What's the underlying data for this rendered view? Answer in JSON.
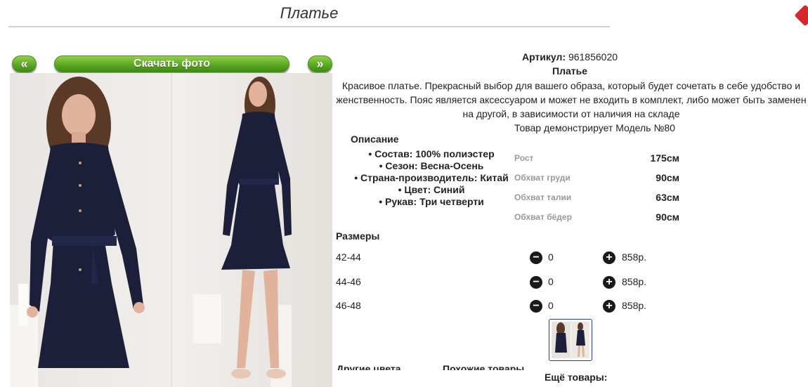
{
  "page": {
    "title": "Платье"
  },
  "toolbar": {
    "prev_label": "«",
    "download_label": "Скачать фото",
    "next_label": "»"
  },
  "product": {
    "artikul_label": "Артикул:",
    "artikul_value": "961856020",
    "name": "Платье",
    "description": "Красивое платье. Прекрасный выбор для вашего образа, который будет сочетать в себе удобство и женственность. Пояс является аксессуаром и может не входить в комплект, либо может быть заменен на другой, в зависимости от наличия на складе",
    "model_note": "Товар демонстрирует Модель №80"
  },
  "description_section": {
    "heading": "Описание",
    "items": [
      "Состав: 100% полиэстер",
      "Сезон: Весна-Осень",
      "Страна-производитель: Китай",
      "Цвет: Синий",
      "Рукав: Три четверти"
    ]
  },
  "measurements": [
    {
      "label": "Рост",
      "value": "175см"
    },
    {
      "label": "Обхват груди",
      "value": "90см"
    },
    {
      "label": "Обхват талии",
      "value": "63см"
    },
    {
      "label": "Обхват бёдер",
      "value": "90см"
    }
  ],
  "sizes": {
    "heading": "Размеры",
    "rows": [
      {
        "size": "42-44",
        "qty": "0",
        "price": "858р."
      },
      {
        "size": "44-46",
        "qty": "0",
        "price": "858р."
      },
      {
        "size": "46-48",
        "qty": "0",
        "price": "858р."
      }
    ]
  },
  "footer": {
    "more_label": "Ещё товары:",
    "other_colors": "Другие цвета",
    "similar": "Похожие товары"
  },
  "colors": {
    "accent_green": "#5ea824",
    "dress_navy": "#1b1f3a",
    "corner_red": "#d8262b"
  }
}
